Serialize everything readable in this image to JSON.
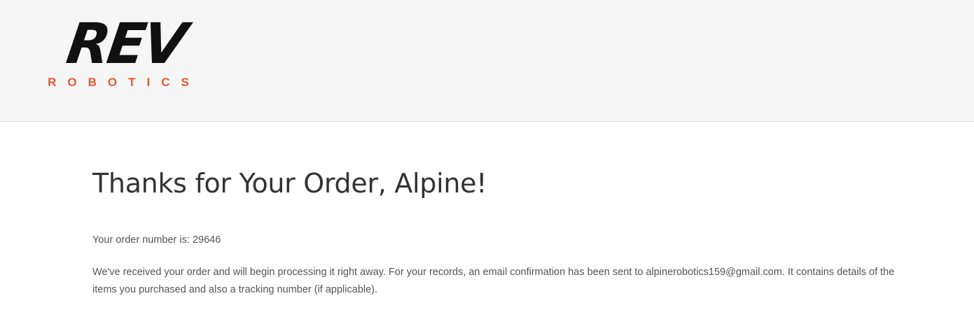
{
  "header": {
    "logo_word": "REV",
    "logo_sub": "ROBOTICS",
    "logo_sub_color": "#e4572e"
  },
  "main": {
    "title": "Thanks for Your Order, Alpine!",
    "order_label": "Your order number is:",
    "order_number": "29646",
    "message": "We've received your order and will begin processing it right away. For your records, an email confirmation has been sent to alpinerobotics159@gmail.com. It contains details of the items you purchased and also a tracking number (if applicable)."
  }
}
